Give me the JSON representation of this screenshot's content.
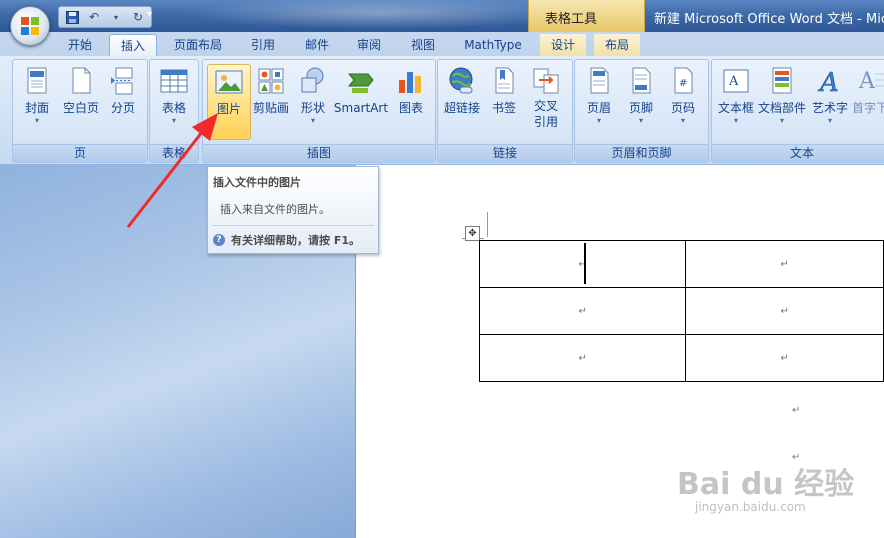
{
  "window": {
    "contextual_group": "表格工具",
    "doc_title": "新建 Microsoft Office Word 文档 - Micro"
  },
  "tabs": [
    {
      "label": "开始"
    },
    {
      "label": "插入"
    },
    {
      "label": "页面布局"
    },
    {
      "label": "引用"
    },
    {
      "label": "邮件"
    },
    {
      "label": "审阅"
    },
    {
      "label": "视图"
    },
    {
      "label": "MathType"
    },
    {
      "label": "设计"
    },
    {
      "label": "布局"
    }
  ],
  "ribbon": {
    "groups": {
      "pages": {
        "label": "页",
        "buttons": [
          "封面",
          "空白页",
          "分页"
        ]
      },
      "tables": {
        "label": "表格",
        "buttons": [
          "表格"
        ]
      },
      "illustrations": {
        "label": "插图",
        "buttons": [
          "图片",
          "剪贴画",
          "形状",
          "SmartArt",
          "图表"
        ]
      },
      "links": {
        "label": "链接",
        "buttons": [
          "超链接",
          "书签",
          "交叉\n引用"
        ]
      },
      "header_footer": {
        "label": "页眉和页脚",
        "buttons": [
          "页眉",
          "页脚",
          "页码"
        ]
      },
      "text": {
        "label": "文本",
        "buttons": [
          "文本框",
          "文档部件",
          "艺术字",
          "首字下沉"
        ]
      }
    },
    "dropdown_glyph": "▾"
  },
  "tooltip": {
    "title": "插入文件中的图片",
    "description": "插入来自文件的图片。",
    "help": "有关详细帮助，请按 F1。",
    "help_icon": "?"
  },
  "document": {
    "paragraph_mark": "↵",
    "table_move_glyph": "✥"
  },
  "watermark": {
    "main": "Bai du 经验",
    "sub": "jingyan.baidu.com"
  }
}
